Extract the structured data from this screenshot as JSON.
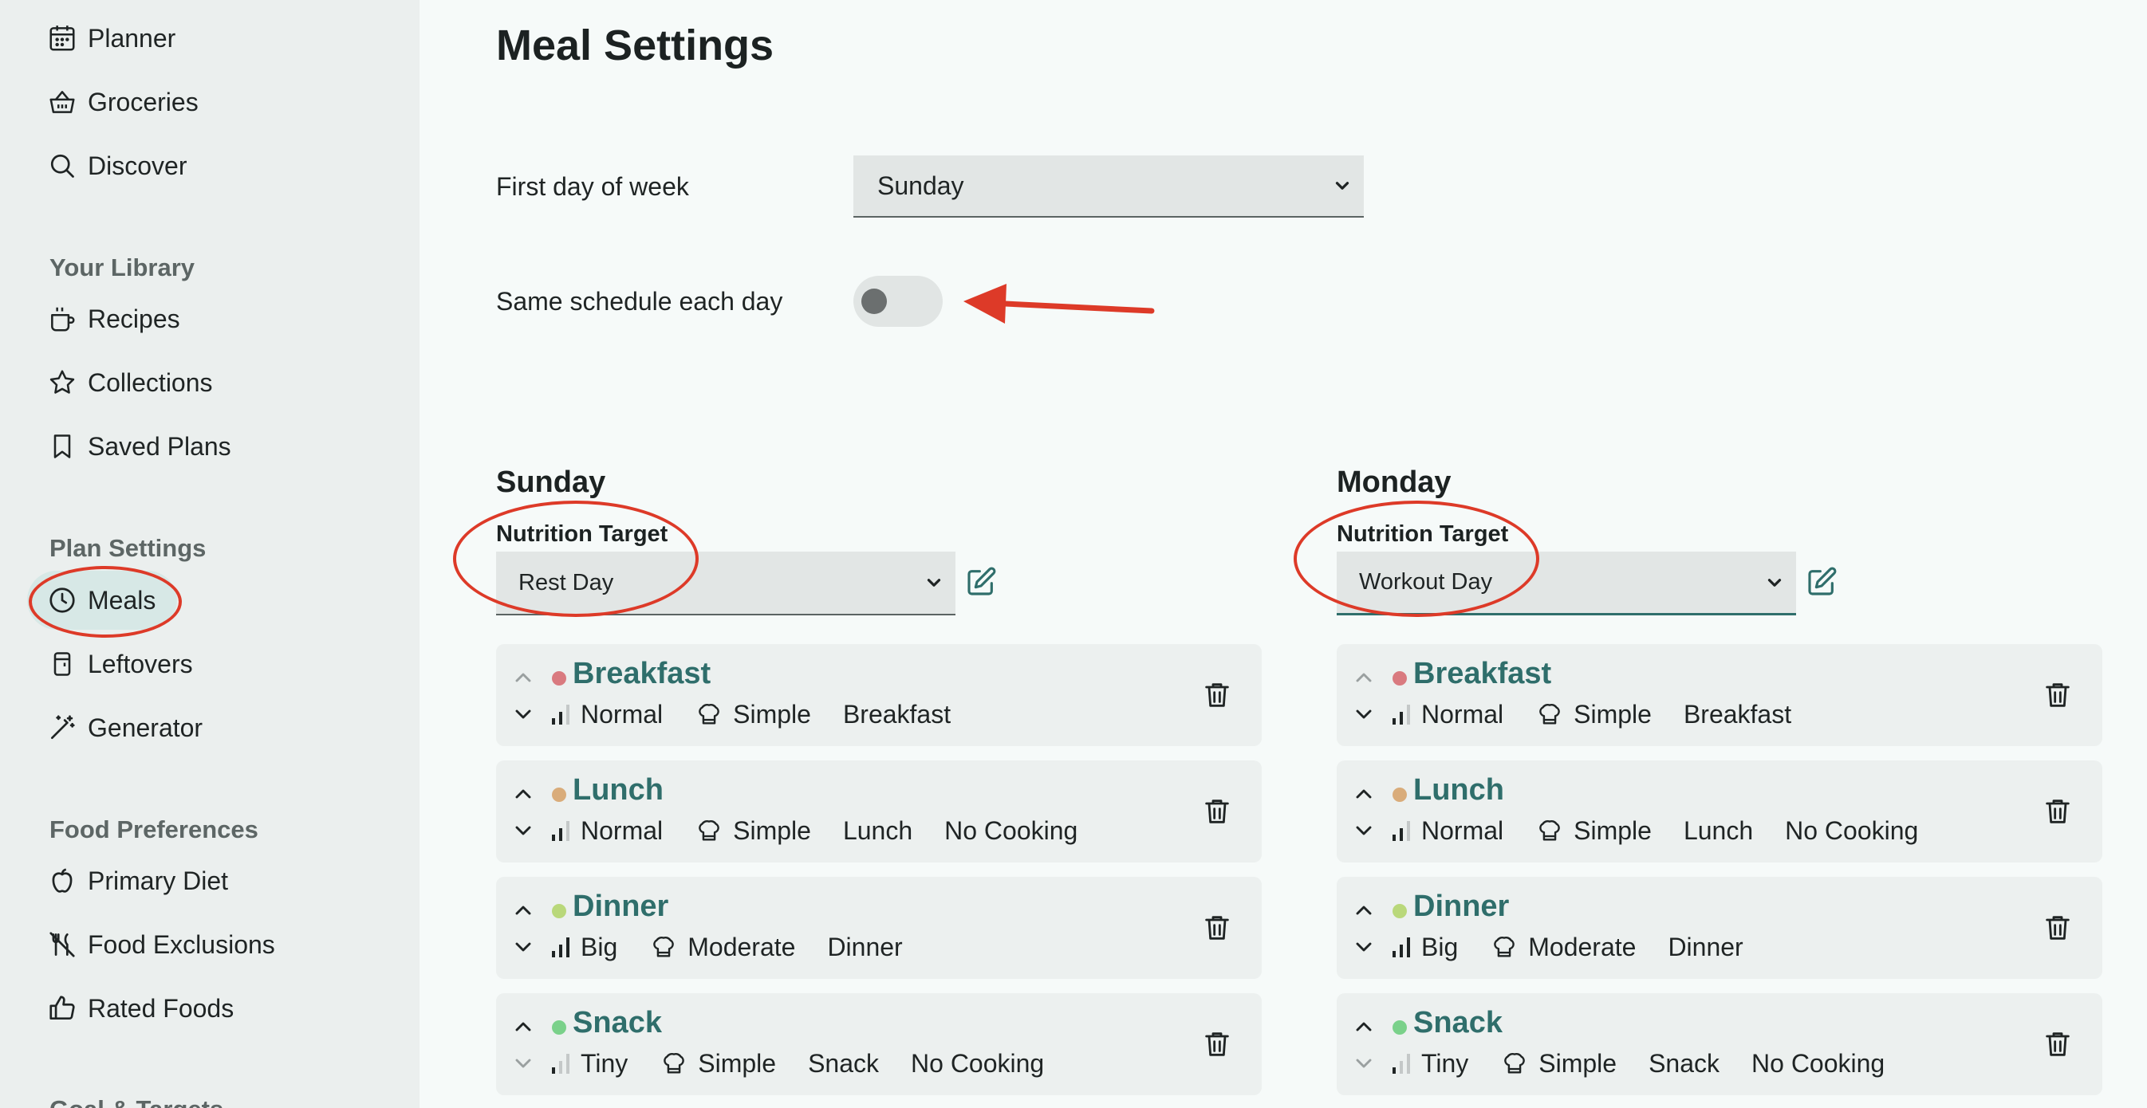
{
  "sidebar": {
    "items": [
      {
        "label": "Planner",
        "icon": "calendar-icon"
      },
      {
        "label": "Groceries",
        "icon": "basket-icon"
      },
      {
        "label": "Discover",
        "icon": "search-icon"
      }
    ],
    "library_title": "Your Library",
    "library_items": [
      {
        "label": "Recipes",
        "icon": "pot-icon"
      },
      {
        "label": "Collections",
        "icon": "star-icon"
      },
      {
        "label": "Saved Plans",
        "icon": "bookmark-icon"
      }
    ],
    "plan_title": "Plan Settings",
    "plan_items": [
      {
        "label": "Meals",
        "icon": "clock-icon"
      },
      {
        "label": "Leftovers",
        "icon": "container-icon"
      },
      {
        "label": "Generator",
        "icon": "magic-wand-icon"
      }
    ],
    "food_title": "Food Preferences",
    "food_items": [
      {
        "label": "Primary Diet",
        "icon": "apple-icon"
      },
      {
        "label": "Food Exclusions",
        "icon": "no-food-icon"
      },
      {
        "label": "Rated Foods",
        "icon": "thumbs-up-icon"
      }
    ],
    "goals_title": "Goal & Targets"
  },
  "main": {
    "title": "Meal Settings",
    "first_day_label": "First day of week",
    "first_day_value": "Sunday",
    "same_schedule_label": "Same schedule each day",
    "same_schedule_on": false,
    "nutrition_label": "Nutrition Target",
    "days": [
      {
        "name": "Sunday",
        "target": "Rest Day",
        "meals": [
          {
            "name": "Breakfast",
            "color": "#d97a7f",
            "size": "Normal",
            "complexity": "Simple",
            "type": "Breakfast",
            "extra": ""
          },
          {
            "name": "Lunch",
            "color": "#d9ac7a",
            "size": "Normal",
            "complexity": "Simple",
            "type": "Lunch",
            "extra": "No Cooking"
          },
          {
            "name": "Dinner",
            "color": "#b9d87a",
            "size": "Big",
            "complexity": "Moderate",
            "type": "Dinner",
            "extra": ""
          },
          {
            "name": "Snack",
            "color": "#7ad18a",
            "size": "Tiny",
            "complexity": "Simple",
            "type": "Snack",
            "extra": "No Cooking"
          }
        ]
      },
      {
        "name": "Monday",
        "target": "Workout Day",
        "meals": [
          {
            "name": "Breakfast",
            "color": "#d97a7f",
            "size": "Normal",
            "complexity": "Simple",
            "type": "Breakfast",
            "extra": ""
          },
          {
            "name": "Lunch",
            "color": "#d9ac7a",
            "size": "Normal",
            "complexity": "Simple",
            "type": "Lunch",
            "extra": "No Cooking"
          },
          {
            "name": "Dinner",
            "color": "#b9d87a",
            "size": "Big",
            "complexity": "Moderate",
            "type": "Dinner",
            "extra": ""
          },
          {
            "name": "Snack",
            "color": "#7ad18a",
            "size": "Tiny",
            "complexity": "Simple",
            "type": "Snack",
            "extra": "No Cooking"
          }
        ]
      }
    ]
  },
  "colors": {
    "accent": "#2f6e6b",
    "annotation": "#dd3a28"
  }
}
